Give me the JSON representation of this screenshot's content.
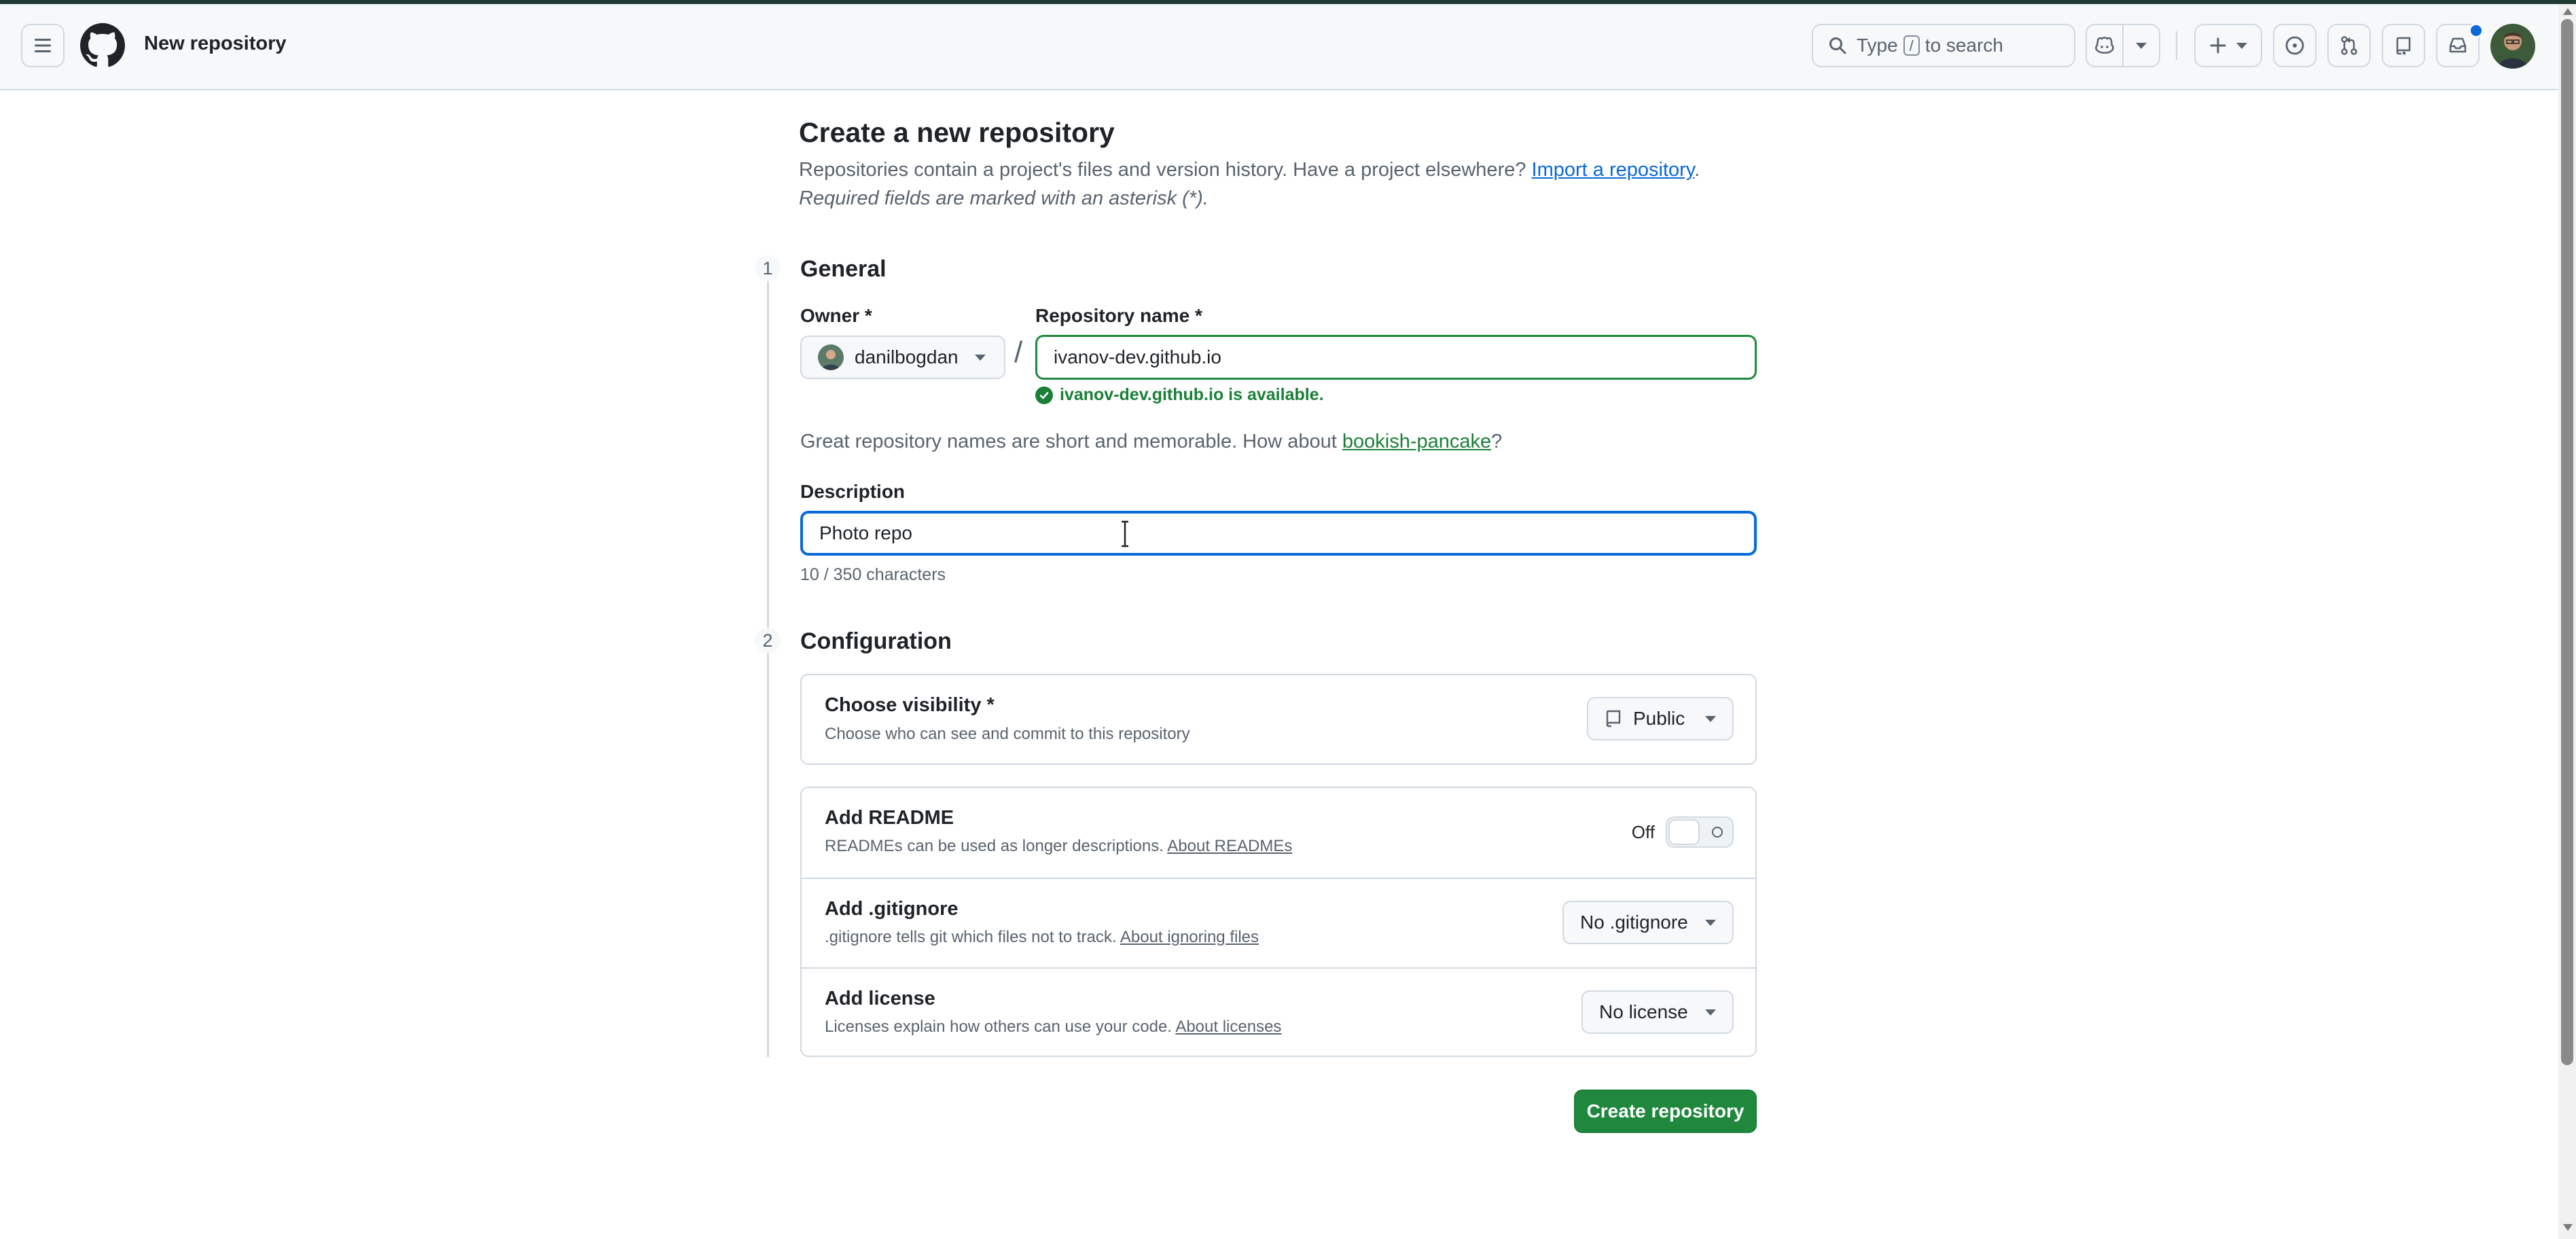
{
  "header": {
    "page_label": "New repository",
    "search": {
      "prefix": "Type",
      "key": "/",
      "suffix": "to search"
    }
  },
  "main": {
    "title": "Create a new repository",
    "intro_text": "Repositories contain a project's files and version history. Have a project elsewhere? ",
    "import_link": "Import a repository",
    "intro_end": ".",
    "required_note": "Required fields are marked with an asterisk (*)."
  },
  "general": {
    "step": "1",
    "title": "General",
    "owner_label": "Owner *",
    "owner_value": "danilbogdan",
    "separator": "/",
    "repo_name_label": "Repository name *",
    "repo_name_value": "ivanov-dev.github.io",
    "availability": "ivanov-dev.github.io is available.",
    "suggestion_prefix": "Great repository names are short and memorable. How about ",
    "suggestion_link": "bookish-pancake",
    "suggestion_suffix": "?",
    "description_label": "Description",
    "description_value": "Photo repo",
    "char_count": "10 / 350 characters"
  },
  "configuration": {
    "step": "2",
    "title": "Configuration",
    "visibility": {
      "title": "Choose visibility *",
      "subtitle": "Choose who can see and commit to this repository",
      "value": "Public"
    },
    "readme": {
      "title": "Add README",
      "subtitle": "READMEs can be used as longer descriptions. ",
      "link": "About READMEs",
      "toggle_label": "Off",
      "enabled": false
    },
    "gitignore": {
      "title": "Add .gitignore",
      "subtitle": ".gitignore tells git which files not to track. ",
      "link": "About ignoring files",
      "value": "No .gitignore"
    },
    "license": {
      "title": "Add license",
      "subtitle": "Licenses explain how others can use your code. ",
      "link": "About licenses",
      "value": "No license"
    }
  },
  "actions": {
    "create_label": "Create repository"
  },
  "colors": {
    "accent": "#0969da",
    "success": "#1a7f37",
    "primary_button": "#1f883d",
    "border": "#d1d9e0",
    "muted_text": "#59636e"
  }
}
